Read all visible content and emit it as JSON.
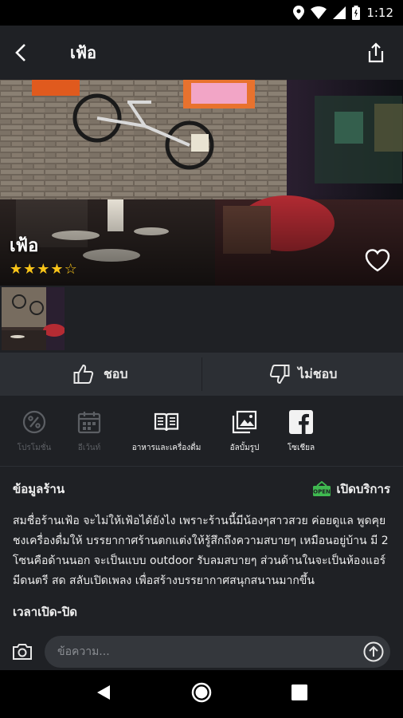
{
  "status_bar": {
    "time": "1:12"
  },
  "app_bar": {
    "title": "เฟ้อ"
  },
  "hero": {
    "name": "เฟ้อ",
    "rating": 4,
    "rating_max": 5
  },
  "vote": {
    "like_label": "ชอบ",
    "dislike_label": "ไม่ชอบ"
  },
  "tabs": [
    {
      "label": "โปรโมชั่น",
      "icon": "percent-icon",
      "enabled": false
    },
    {
      "label": "อีเว้นท์",
      "icon": "calendar-icon",
      "enabled": false
    },
    {
      "label": "อาหารและเครื่องดื่ม",
      "icon": "menu-book-icon",
      "enabled": true
    },
    {
      "label": "อัลบั้มรูป",
      "icon": "photo-album-icon",
      "enabled": true
    },
    {
      "label": "โซเชียล",
      "icon": "facebook-icon",
      "enabled": true
    }
  ],
  "info": {
    "title": "ข้อมูลร้าน",
    "status_label": "เปิดบริการ",
    "status_badge_text": "OPEN",
    "description": "สมชื่อร้านเฟ้อ จะไม่ให้เฟ้อได้ยังไง เพราะร้านนี้มีน้องๆสาวสวย ค่อยดูแล พูดคุย ชงเครื่องดื่มให้ บรรยากาศร้านตกแต่งให้รู้สึกถึงความสบายๆ เหมือนอยู่บ้าน มี 2 โซนคือด้านนอก จะเป็นแบบ outdoor รับลมสบายๆ ส่วนด้านในจะเป็นห้องแอร์ มีดนตรี สด สลับเปิดเพลง เพื่อสร้างบรรยากาศสนุกสนานมากขึ้น",
    "hours_title": "เวลาเปิด-ปิด"
  },
  "compose": {
    "placeholder": "ข้อความ..."
  },
  "colors": {
    "background": "#1f2125",
    "accent_green": "#3fb950",
    "star": "#f8c419"
  }
}
